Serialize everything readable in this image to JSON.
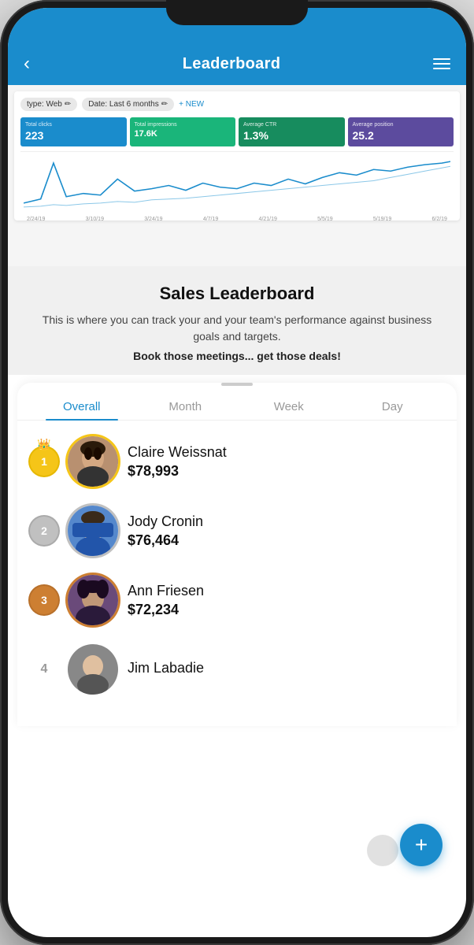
{
  "phone": {
    "header": {
      "back_label": "‹",
      "title": "Leaderboard",
      "menu_label": "☰"
    },
    "screenshot": {
      "filters": [
        "type: Web",
        "Date: Last 6 months"
      ],
      "new_button": "+ NEW",
      "metrics": [
        {
          "label": "Total clicks",
          "value": "223",
          "color": "blue"
        },
        {
          "label": "Total impressions",
          "value": "17.6K",
          "color": "green"
        },
        {
          "label": "Average CTR",
          "value": "1.3%",
          "color": "dark-green"
        },
        {
          "label": "Average position",
          "value": "25.2",
          "color": "purple"
        }
      ],
      "chart_dates": [
        "2/24/19",
        "3/10/19",
        "3/24/19",
        "4/7/19",
        "4/21/19",
        "5/5/19",
        "5/19/19",
        "6/2/19"
      ]
    },
    "intro": {
      "title": "Sales Leaderboard",
      "description": "This is where you can track your and your team's performance against business goals and targets.",
      "cta": "Book those meetings... get those deals!"
    },
    "tabs": [
      {
        "label": "Overall",
        "active": true
      },
      {
        "label": "Month",
        "active": false
      },
      {
        "label": "Week",
        "active": false
      },
      {
        "label": "Day",
        "active": false
      }
    ],
    "leaderboard": [
      {
        "rank": 1,
        "rank_type": "gold",
        "name": "Claire Weissnat",
        "amount": "$78,993",
        "crown": true
      },
      {
        "rank": 2,
        "rank_type": "silver",
        "name": "Jody Cronin",
        "amount": "$76,464",
        "crown": false
      },
      {
        "rank": 3,
        "rank_type": "bronze",
        "name": "Ann Friesen",
        "amount": "$72,234",
        "crown": false
      },
      {
        "rank": 4,
        "rank_type": "plain",
        "name": "Jim Labadie",
        "amount": "",
        "crown": false
      }
    ],
    "fab": {
      "label": "+"
    }
  }
}
